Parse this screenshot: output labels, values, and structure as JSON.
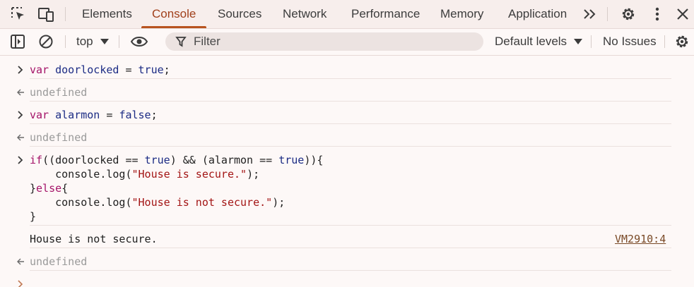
{
  "tabs": [
    {
      "label": "Elements",
      "active": false
    },
    {
      "label": "Console",
      "active": true
    },
    {
      "label": "Sources",
      "active": false
    },
    {
      "label": "Network",
      "active": false
    },
    {
      "label": "Performance",
      "active": false
    },
    {
      "label": "Memory",
      "active": false
    },
    {
      "label": "Application",
      "active": false
    }
  ],
  "toolbar": {
    "context": "top",
    "filter_placeholder": "Filter",
    "levels": "Default levels",
    "issues": "No Issues"
  },
  "console": {
    "entries": [
      {
        "type": "input",
        "lines": [
          [
            {
              "t": "var",
              "c": "kw"
            },
            {
              "t": " ",
              "c": ""
            },
            {
              "t": "doorlocked",
              "c": "vn"
            },
            {
              "t": " = ",
              "c": ""
            },
            {
              "t": "true",
              "c": "lit"
            },
            {
              "t": ";",
              "c": ""
            }
          ]
        ]
      },
      {
        "type": "result",
        "text": "undefined"
      },
      {
        "type": "input",
        "lines": [
          [
            {
              "t": "var",
              "c": "kw"
            },
            {
              "t": " ",
              "c": ""
            },
            {
              "t": "alarmon",
              "c": "vn"
            },
            {
              "t": " = ",
              "c": ""
            },
            {
              "t": "false",
              "c": "lit"
            },
            {
              "t": ";",
              "c": ""
            }
          ]
        ]
      },
      {
        "type": "result",
        "text": "undefined"
      },
      {
        "type": "input",
        "lines": [
          [
            {
              "t": "if",
              "c": "kw"
            },
            {
              "t": "((doorlocked == ",
              "c": ""
            },
            {
              "t": "true",
              "c": "lit"
            },
            {
              "t": ") && (alarmon == ",
              "c": ""
            },
            {
              "t": "true",
              "c": "lit"
            },
            {
              "t": ")){",
              "c": ""
            }
          ],
          [
            {
              "t": "    console.log(",
              "c": ""
            },
            {
              "t": "\"House is secure.\"",
              "c": "str"
            },
            {
              "t": ");",
              "c": ""
            }
          ],
          [
            {
              "t": "}",
              "c": ""
            },
            {
              "t": "else",
              "c": "kw"
            },
            {
              "t": "{",
              "c": ""
            }
          ],
          [
            {
              "t": "    console.log(",
              "c": ""
            },
            {
              "t": "\"House is not secure.\"",
              "c": "str"
            },
            {
              "t": ");",
              "c": ""
            }
          ],
          [
            {
              "t": "}",
              "c": ""
            }
          ]
        ]
      },
      {
        "type": "log",
        "text": "House is not secure.",
        "source": "VM2910:4"
      },
      {
        "type": "result",
        "text": "undefined"
      }
    ]
  },
  "colors": {
    "accent": "#b8531f",
    "keyword": "#a41368",
    "identifier": "#1b2b84",
    "string": "#a31515"
  }
}
